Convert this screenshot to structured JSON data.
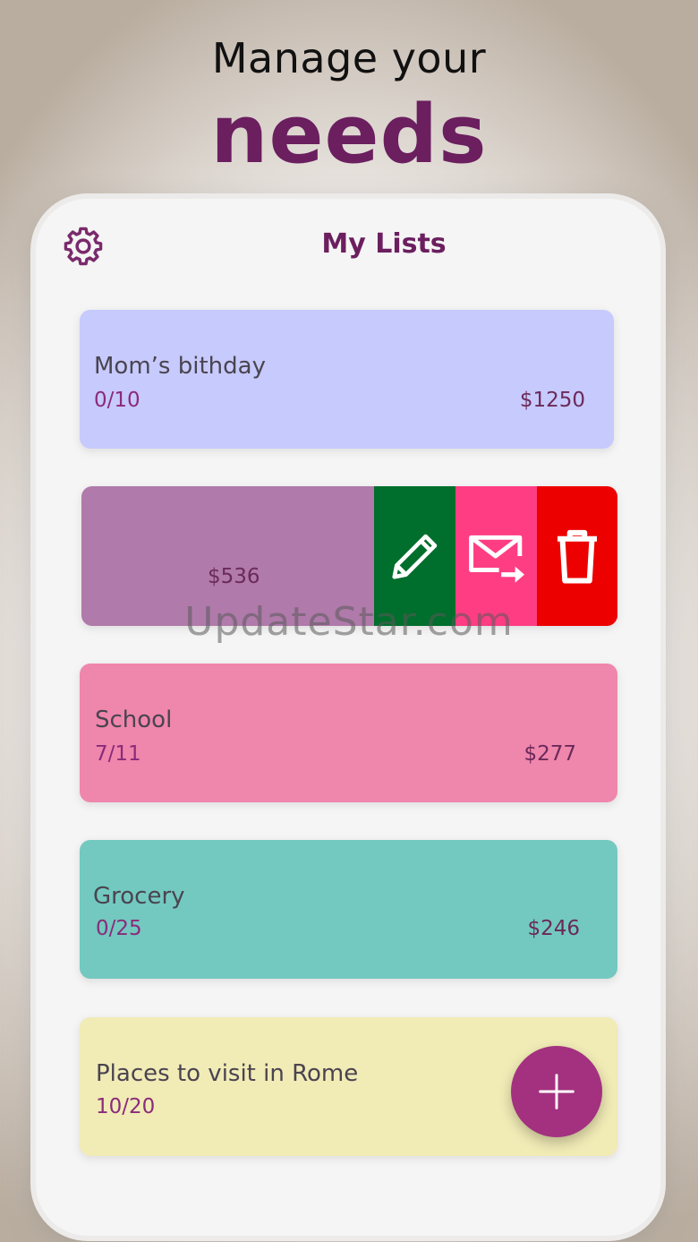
{
  "promo": {
    "line1": "Manage your",
    "line2": "needs"
  },
  "header": {
    "title": "My Lists",
    "settings_icon": "gear-icon"
  },
  "lists": [
    {
      "name": "Mom’s bithday",
      "count": "0/10",
      "price": "$1250",
      "color": "#c7cafd"
    },
    {
      "name": "",
      "count": "",
      "price": "$536",
      "color": "#b07aaa"
    },
    {
      "name": "School",
      "count": "7/11",
      "price": "$277",
      "color": "#ef86ac"
    },
    {
      "name": "Grocery",
      "count": "0/25",
      "price": "$246",
      "color": "#73c9c0"
    },
    {
      "name": "Places to visit in Rome",
      "count": "10/20",
      "price": "",
      "color": "#f1ebb6"
    }
  ],
  "swipe_actions": {
    "edit": {
      "icon": "pencil-icon",
      "color": "#006e2c"
    },
    "share": {
      "icon": "mail-forward-icon",
      "color": "#ff3d82"
    },
    "delete": {
      "icon": "trash-icon",
      "color": "#ec0000"
    }
  },
  "fab": {
    "icon": "plus-icon",
    "color": "#a3317f"
  },
  "watermark": "UpdateStar.com"
}
